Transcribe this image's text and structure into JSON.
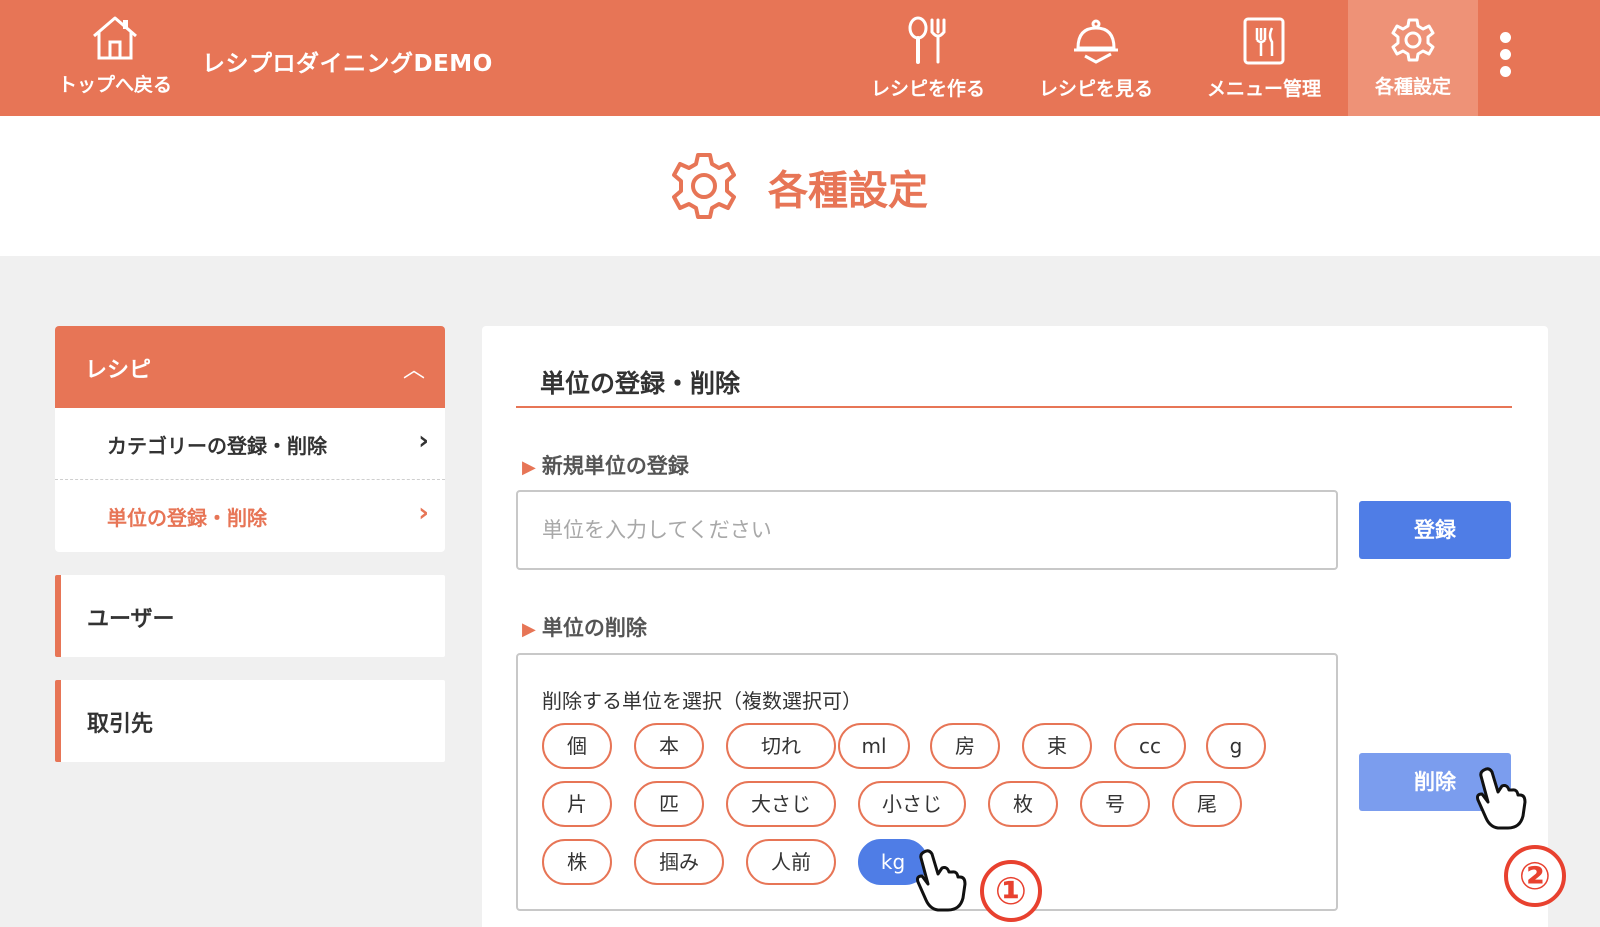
{
  "header": {
    "home_label": "トップへ戻る",
    "brand": "レシプロダイニングDEMO",
    "nav": [
      {
        "label": "レシピを作る",
        "icon": "utensils-icon"
      },
      {
        "label": "レシピを見る",
        "icon": "cloche-icon"
      },
      {
        "label": "メニュー管理",
        "icon": "menu-board-icon"
      },
      {
        "label": "各種設定",
        "icon": "gear-icon",
        "active": true
      }
    ]
  },
  "page_title": "各種設定",
  "sidebar": {
    "recipe_label": "レシピ",
    "recipe_items": [
      {
        "label": "カテゴリーの登録・削除"
      },
      {
        "label": "単位の登録・削除",
        "current": true
      }
    ],
    "users_label": "ユーザー",
    "partners_label": "取引先"
  },
  "main": {
    "title": "単位の登録・削除",
    "register": {
      "heading": "新規単位の登録",
      "placeholder": "単位を入力してください",
      "value": "",
      "button": "登録"
    },
    "delete": {
      "heading": "単位の削除",
      "hint": "削除する単位を選択（複数選択可）",
      "button": "削除",
      "units": [
        "個",
        "本",
        "切れ",
        "ml",
        "房",
        "束",
        "cc",
        "g",
        "片",
        "匹",
        "大さじ",
        "小さじ",
        "枚",
        "号",
        "尾",
        "株",
        "掴み",
        "人前",
        "kg"
      ],
      "selected": [
        "kg"
      ]
    }
  },
  "annotations": {
    "step1": "①",
    "step2": "②"
  },
  "colors": {
    "accent": "#e77556",
    "primary_button": "#4f7de6",
    "annotation": "#e8412f"
  }
}
